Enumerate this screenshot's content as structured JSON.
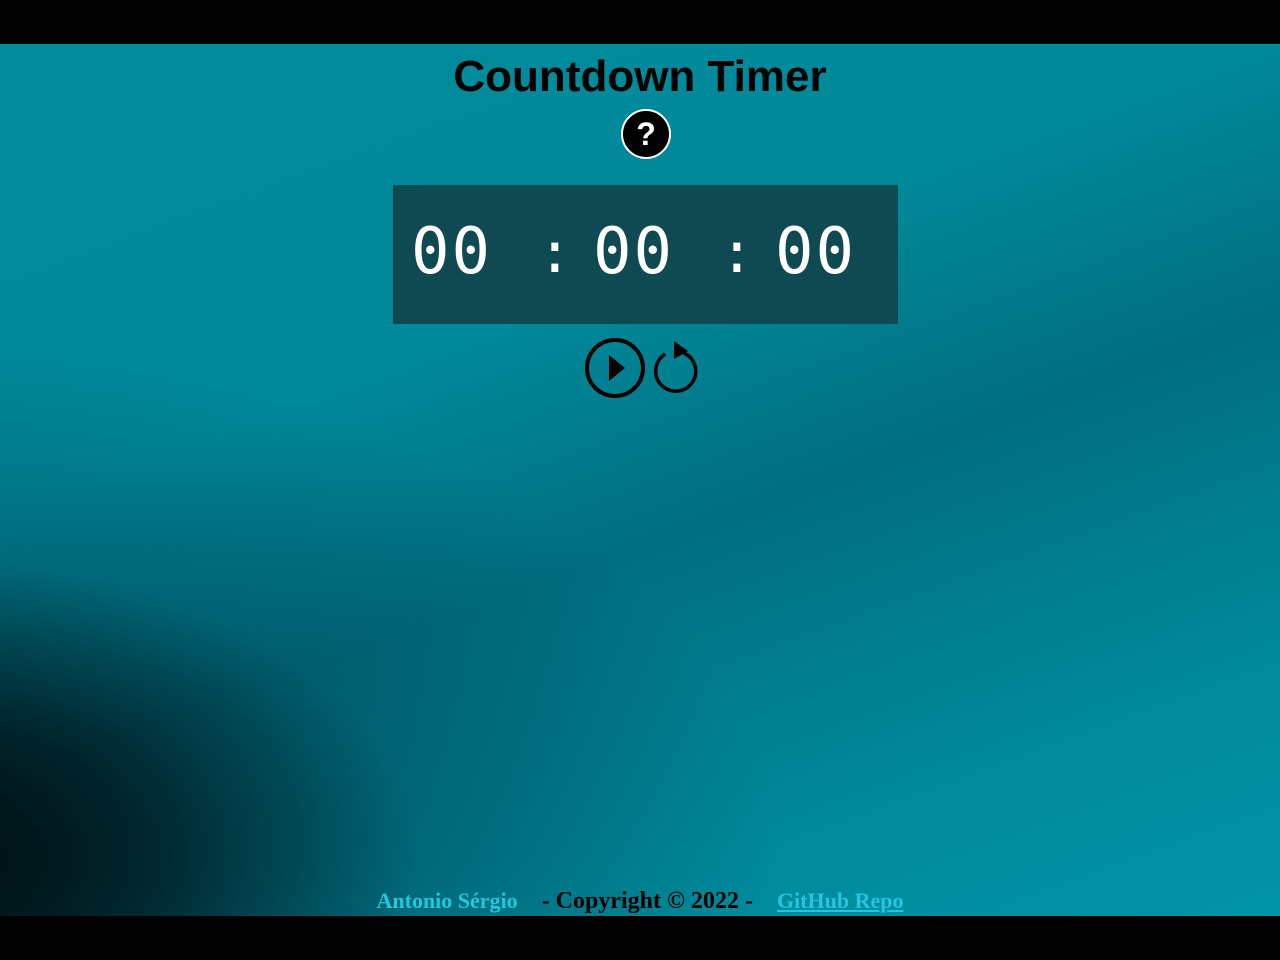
{
  "header": {
    "title": "Countdown Timer",
    "help_label": "?"
  },
  "timer": {
    "hours": "00",
    "minutes": "00",
    "seconds": "00",
    "separator": ":"
  },
  "controls": {
    "play_icon": "play-circle-icon",
    "reset_icon": "reset-icon"
  },
  "footer": {
    "author": "Antonio Sérgio",
    "copyright": "- Copyright © 2022 -",
    "link_label": "GitHub Repo"
  },
  "colors": {
    "background": "#008a9a",
    "display_background": "#0f4a53",
    "accent": "#22c7dd",
    "letterbox": "#000000"
  }
}
